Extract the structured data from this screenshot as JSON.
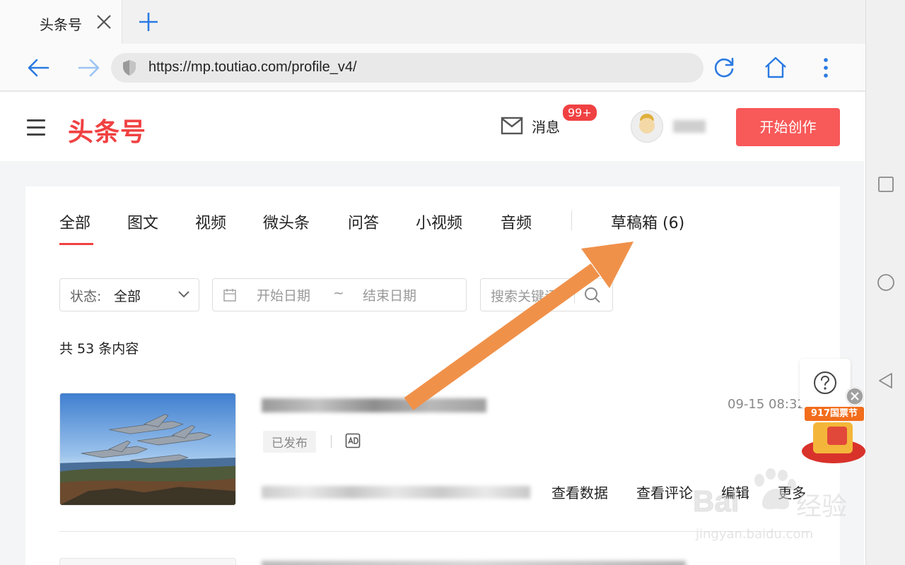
{
  "browser": {
    "tab_title": "头条号",
    "url": "https://mp.toutiao.com/profile_v4/"
  },
  "header": {
    "logo": "头条号",
    "messages_label": "消息",
    "messages_badge": "99+",
    "create_button": "开始创作"
  },
  "tabs": [
    {
      "label": "全部",
      "active": true
    },
    {
      "label": "图文"
    },
    {
      "label": "视频"
    },
    {
      "label": "微头条"
    },
    {
      "label": "问答"
    },
    {
      "label": "小视频"
    },
    {
      "label": "音频"
    },
    {
      "label": "草稿箱 (6)"
    }
  ],
  "filters": {
    "status_label": "状态:",
    "status_value": "全部",
    "start_date_placeholder": "开始日期",
    "date_separator": "~",
    "end_date_placeholder": "结束日期",
    "search_placeholder": "搜索关键词"
  },
  "content_count": "共 53 条内容",
  "items": [
    {
      "status": "已发布",
      "time": "09-15 08:32",
      "actions": [
        "查看数据",
        "查看评论",
        "编辑",
        "更多"
      ]
    }
  ],
  "promo": {
    "banner": "917国票节"
  },
  "watermark": {
    "logo": "Bai",
    "logo_cn": "经验",
    "url": "jingyan.baidu.com"
  },
  "colors": {
    "brand_red": "#f04142",
    "create_button": "#f85959",
    "annotation_arrow": "#f0914a"
  }
}
